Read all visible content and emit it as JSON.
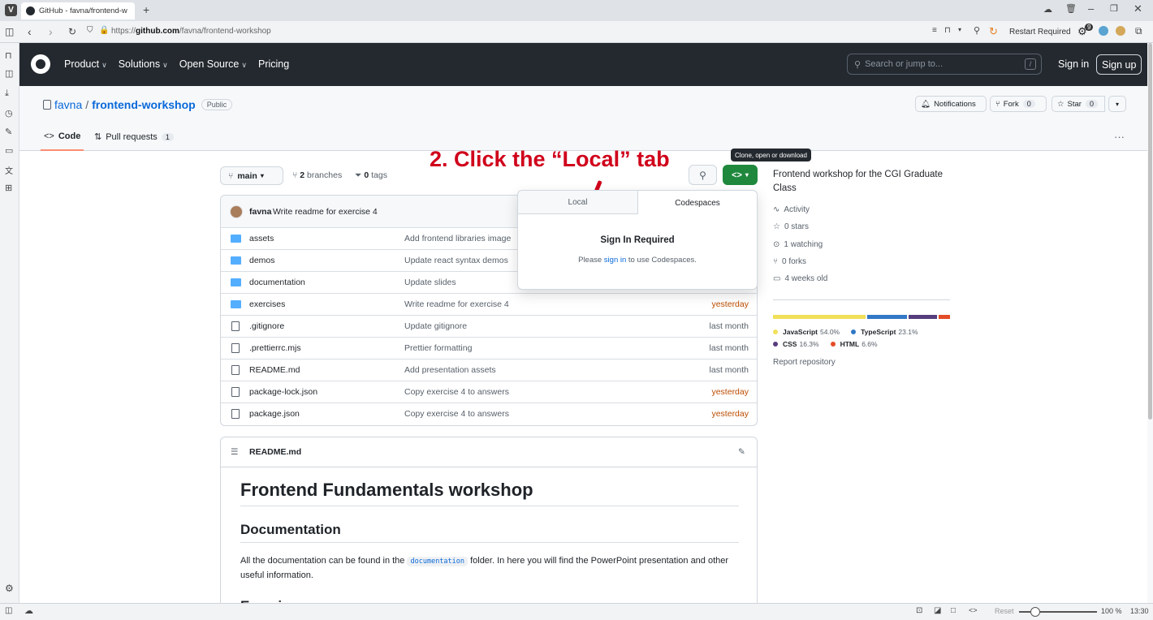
{
  "browser": {
    "tab_title": "GitHub - favna/frontend-w",
    "url_prefix": "https://",
    "url_host": "github.com",
    "url_path": "/favna/frontend-workshop",
    "restart_label": "Restart Required",
    "extension_badge": "9"
  },
  "header": {
    "nav": [
      "Product",
      "Solutions",
      "Open Source",
      "Pricing"
    ],
    "search_placeholder": "Search or jump to...",
    "search_key": "/",
    "sign_in": "Sign in",
    "sign_up": "Sign up"
  },
  "repo": {
    "owner": "favna",
    "separator": "/",
    "name": "frontend-workshop",
    "visibility": "Public",
    "notifications": "Notifications",
    "fork_label": "Fork",
    "fork_count": "0",
    "star_label": "Star",
    "star_count": "0",
    "tabs": [
      {
        "label": "Code"
      },
      {
        "label": "Pull requests",
        "count": "1"
      }
    ]
  },
  "toolbar": {
    "branch": "main",
    "branches_count": "2",
    "branches_label": "branches",
    "tags_count": "0",
    "tags_label": "tags",
    "tooltip": "Clone, open or download"
  },
  "commit": {
    "author": "favna",
    "message": "Write readme for exercise 4"
  },
  "files": [
    {
      "name": "assets",
      "type": "folder",
      "message": "Add frontend libraries image",
      "date": ""
    },
    {
      "name": "demos",
      "type": "folder",
      "message": "Update react syntax demos",
      "date": ""
    },
    {
      "name": "documentation",
      "type": "folder",
      "message": "Update slides",
      "date": ""
    },
    {
      "name": "exercises",
      "type": "folder",
      "message": "Write readme for exercise 4",
      "date": "yesterday"
    },
    {
      "name": ".gitignore",
      "type": "file",
      "message": "Update gitignore",
      "date": "last month"
    },
    {
      "name": ".prettierrc.mjs",
      "type": "file",
      "message": "Prettier formatting",
      "date": "last month"
    },
    {
      "name": "README.md",
      "type": "file",
      "message": "Add presentation assets",
      "date": "last month"
    },
    {
      "name": "package-lock.json",
      "type": "file",
      "message": "Copy exercise 4 to answers",
      "date": "yesterday"
    },
    {
      "name": "package.json",
      "type": "file",
      "message": "Copy exercise 4 to answers",
      "date": "yesterday"
    }
  ],
  "dropdown": {
    "tab_local": "Local",
    "tab_codespaces": "Codespaces",
    "title": "Sign In Required",
    "text_before": "Please ",
    "link": "sign in",
    "text_after": " to use Codespaces."
  },
  "annotation": "2. Click the “Local” tab",
  "about": {
    "description": "Frontend workshop for the CGI Graduate Class",
    "activity": "Activity",
    "stars": "0 stars",
    "watching": "1 watching",
    "forks": "0 forks",
    "age": "4 weeks old",
    "report": "Report repository"
  },
  "languages": [
    {
      "name": "JavaScript",
      "percent": "54.0%",
      "value": 54.0,
      "color": "#f1e05a"
    },
    {
      "name": "TypeScript",
      "percent": "23.1%",
      "value": 23.1,
      "color": "#3178c6"
    },
    {
      "name": "CSS",
      "percent": "16.3%",
      "value": 16.3,
      "color": "#563d7c"
    },
    {
      "name": "HTML",
      "percent": "6.6%",
      "value": 6.6,
      "color": "#e34c26"
    }
  ],
  "readme": {
    "filename": "README.md",
    "h1": "Frontend Fundamentals workshop",
    "h2": "Documentation",
    "p_before": "All the documentation can be found in the ",
    "code": "documentation",
    "p_after": " folder. In here you will find the PowerPoint presentation and other useful information.",
    "h2_next": "Exercises"
  },
  "status": {
    "reset": "Reset",
    "zoom": "100 %",
    "time": "13:30"
  },
  "colors": {
    "header_bg": "#24292f",
    "green": "#1f883d",
    "link": "#0969da",
    "annotation": "#d0021b",
    "date_recent": "#bc4c00"
  }
}
